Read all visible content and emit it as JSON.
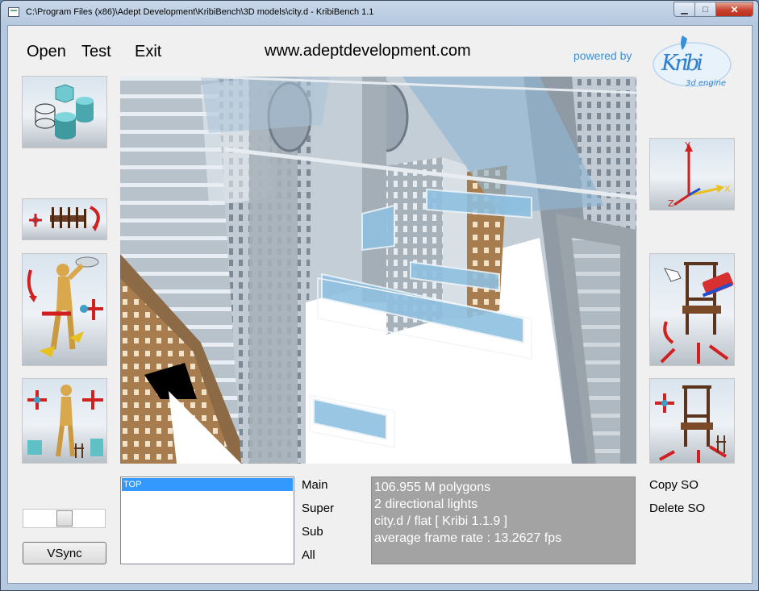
{
  "window": {
    "title": "C:\\Program Files (x86)\\Adept Development\\KribiBench\\3D models\\city.d - KribiBench 1.1"
  },
  "menu": {
    "open": "Open",
    "test": "Test",
    "exit": "Exit"
  },
  "header": {
    "url": "www.adeptdevelopment.com",
    "powered_by": "powered by",
    "logo": {
      "name": "Kribi",
      "subtitle": "3d engine"
    }
  },
  "tools": {
    "left": [
      "primitives-tool",
      "scene-rotate-tool",
      "walk-camera-tool",
      "mannequin-move-tool"
    ],
    "right": [
      "axis-tool",
      "object-pick-tool",
      "object-move-tool"
    ]
  },
  "axes": {
    "x": "X",
    "y": "Y",
    "z": "Z"
  },
  "scene_objects": {
    "items": [
      "TOP"
    ],
    "selected": "TOP"
  },
  "levels": {
    "main": "Main",
    "super": "Super",
    "sub": "Sub",
    "all": "All"
  },
  "stats": {
    "polygons": "106.955 M polygons",
    "lights": "2 directional lights",
    "model": "city.d / flat [ Kribi 1.1.9 ]",
    "frame_rate": "average frame rate :  13.2627 fps"
  },
  "actions": {
    "copy": "Copy SO",
    "delete": "Delete SO"
  },
  "vsync": {
    "label": "VSync",
    "slider_level": 0.45
  },
  "colors": {
    "accent": "#3a8fd8",
    "selection": "#3399ff",
    "info_panel": "#a3a3a3"
  }
}
